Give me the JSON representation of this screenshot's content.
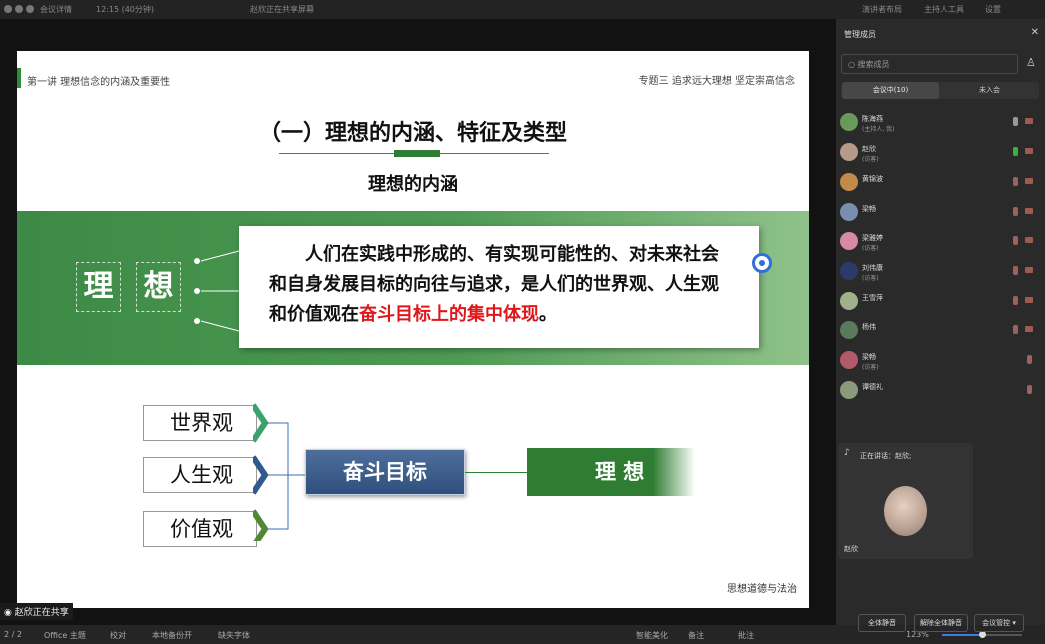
{
  "topbar": {
    "meeting_details": "会议详情",
    "time": "12:15 (40分钟)",
    "sharing_notice": "赵欣正在共享屏幕",
    "speaker_view": "演讲者布局",
    "ai_host": "主持人工具",
    "settings": "设置"
  },
  "slide": {
    "header_left": "第一讲 理想信念的内涵及重要性",
    "header_right": "专题三 追求远大理想   坚定崇高信念",
    "title": "（一）理想的内涵、特征及类型",
    "subtitle": "理想的内涵",
    "char1": "理",
    "char2": "想",
    "definition_part1": "人们在实践中形成的、有实现可能性的、对未来社会和自身发展目标的向往与追求，是人们的世界观、人生观和价值观在",
    "definition_highlight": "奋斗目标上的集中体现",
    "definition_end": "。",
    "box1": "世界观",
    "box2": "人生观",
    "box3": "价值观",
    "goal": "奋斗目标",
    "ideal": "理  想",
    "footer": "思想道德与法治"
  },
  "share_status": "赵欣正在共享",
  "statusbar": {
    "page": "2 / 2",
    "theme": "Office 主题",
    "proof": "校对",
    "backup": "本地备份开",
    "missing_font": "缺失字体",
    "beautify": "智能美化",
    "notes": "备注",
    "comments": "批注",
    "zoom": "123%"
  },
  "panel": {
    "title": "管理成员",
    "search_placeholder": "搜索成员",
    "tab_in": "会议中(10)",
    "tab_not": "未入会",
    "members": [
      {
        "name": "陈海燕",
        "role": "(主持人, 我)"
      },
      {
        "name": "赵欣",
        "role": "(访客)"
      },
      {
        "name": "黄锦波",
        "role": ""
      },
      {
        "name": "梁畅",
        "role": ""
      },
      {
        "name": "梁雅婷",
        "role": "(访客)"
      },
      {
        "name": "刘伟康",
        "role": "(访客)"
      },
      {
        "name": "王雪萍",
        "role": ""
      },
      {
        "name": "杨伟",
        "role": ""
      },
      {
        "name": "梁畅",
        "role": "(访客)"
      },
      {
        "name": "谭德礼",
        "role": ""
      }
    ],
    "speaking_label": "正在讲话：赵欣;",
    "speaker_name": "赵欣",
    "mute_all": "全体静音",
    "unmute_all": "解除全体静音",
    "meeting_control": "会议管控 ▾"
  }
}
